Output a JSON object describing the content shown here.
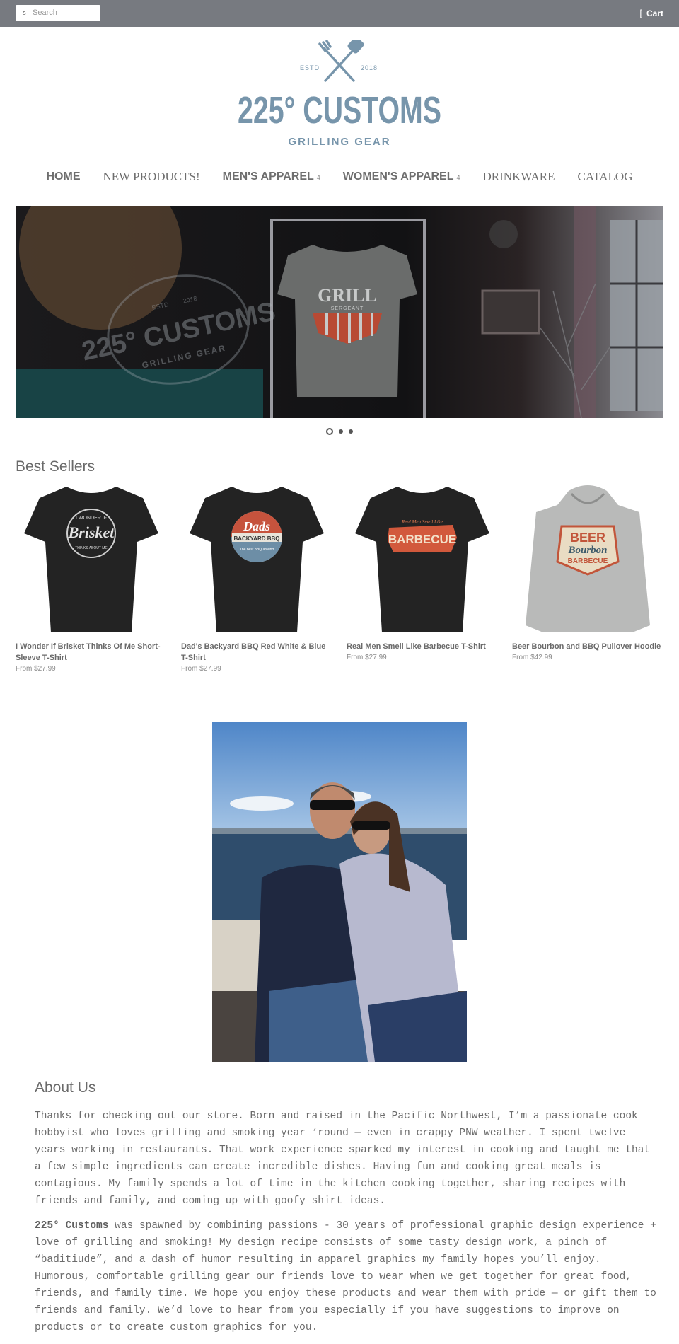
{
  "topbar": {
    "search_placeholder": "Search",
    "search_icon": "search-icon",
    "cart_label": "Cart",
    "cart_icon": "cart-icon",
    "background": "#777a80"
  },
  "logo": {
    "estd": "ESTD",
    "year": "2018",
    "brand": "225° CUSTOMS",
    "tagline": "GRILLING GEAR",
    "color": "#7795ab"
  },
  "nav": {
    "items": [
      {
        "label": "HOME"
      },
      {
        "label": "NEW PRODUCTS!"
      },
      {
        "label": "MEN'S APPAREL",
        "caret": "4"
      },
      {
        "label": "WOMEN'S APPAREL",
        "caret": "4"
      },
      {
        "label": "DRINKWARE"
      },
      {
        "label": "CATALOG"
      }
    ]
  },
  "hero": {
    "shirt_title": "GRILL",
    "shirt_subtitle": "SERGEANT",
    "watermark_estd": "ESTD",
    "watermark_year": "2018",
    "watermark_brand": "225° CUSTOMS",
    "watermark_tagline": "GRILLING GEAR",
    "slides": 3,
    "active_slide": 1
  },
  "best_sellers": {
    "title": "Best Sellers",
    "products": [
      {
        "name": "I Wonder If Brisket Thinks Of Me Short-Sleeve T-Shirt",
        "price": "From $27.99",
        "art_top": "I WONDER IF",
        "art_main": "Brisket",
        "art_bottom": "THINKS ABOUT ME"
      },
      {
        "name": "Dad's Backyard BBQ Red White & Blue T-Shirt",
        "price": "From $27.99",
        "art_top": "Dads",
        "art_main": "BACKYARD BBQ",
        "art_bottom": "The best BBQ around"
      },
      {
        "name": "Real Men Smell Like Barbecue T-Shirt",
        "price": "From $27.99",
        "art_top": "Real Men Smell Like",
        "art_main": "BARBECUE",
        "art_bottom": ""
      },
      {
        "name": "Beer Bourbon and BBQ Pullover Hoodie",
        "price": "From $42.99",
        "art_top": "BEER",
        "art_main": "Bourbon",
        "art_bottom": "BARBECUE"
      }
    ]
  },
  "about": {
    "title": "About Us",
    "paragraph1": "Thanks for checking out our store. Born and raised in the Pacific Northwest, I’m a passionate cook hobbyist who loves grilling and smoking year ‘round — even in crappy PNW weather. I spent twelve years working in restaurants. That work experience sparked my interest in cooking and taught me that a few simple ingredients can create incredible dishes. Having fun and cooking great meals is contagious. My family spends a lot of time in the kitchen cooking together, sharing recipes with friends and family, and coming up with goofy shirt ideas.",
    "paragraph2_bold": "225° Customs",
    "paragraph2": " was spawned by combining passions - 30 years of professional graphic design experience + love of grilling and smoking! My design recipe consists of some tasty design work, a pinch of “baditiude”, and a dash of humor resulting in apparel graphics my family hopes you’ll enjoy. Humorous, comfortable grilling gear our friends love to wear when we get together for great food, friends, and family time. We hope you enjoy these products and wear them with pride — or gift them to friends and family. We’d love to hear from you especially if you have suggestions to improve on products or to create custom graphics for you."
  }
}
